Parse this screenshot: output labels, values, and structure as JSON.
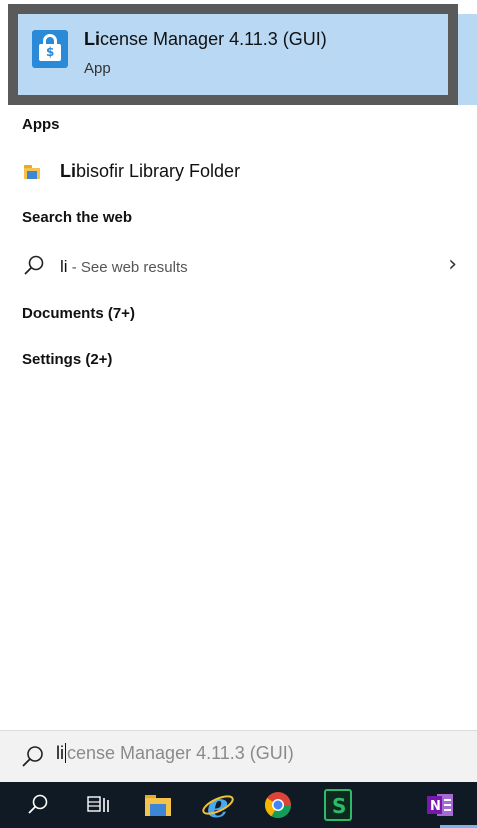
{
  "best_match": {
    "title_bold": "Li",
    "title_rest": "cense Manager 4.11.3 (GUI)",
    "subtitle": "App",
    "icon": "lock-icon"
  },
  "sections": {
    "apps": {
      "header": "Apps",
      "items": [
        {
          "bold": "Li",
          "rest": "bisofir Library Folder",
          "icon": "folder-icon"
        }
      ]
    },
    "web": {
      "header": "Search the web",
      "query": "li",
      "hint": " - See web results",
      "chevron": "›"
    },
    "documents": {
      "header": "Documents (7+)"
    },
    "settings": {
      "header": "Settings (2+)"
    }
  },
  "search_box": {
    "typed": "li",
    "suggestion": "cense Manager 4.11.3 (GUI)"
  },
  "taskbar": {
    "items": [
      {
        "icon": "search-icon"
      },
      {
        "icon": "task-view-icon"
      },
      {
        "icon": "file-explorer-icon"
      },
      {
        "icon": "internet-explorer-icon"
      },
      {
        "icon": "chrome-icon"
      },
      {
        "icon": "green-s-app-icon"
      },
      {
        "icon": "onenote-icon"
      }
    ]
  },
  "colors": {
    "selection": "#b9d8f3",
    "selection_border": "#5a5a5a",
    "taskbar": "#0f1a25",
    "app_icon": "#2b8ad8"
  }
}
